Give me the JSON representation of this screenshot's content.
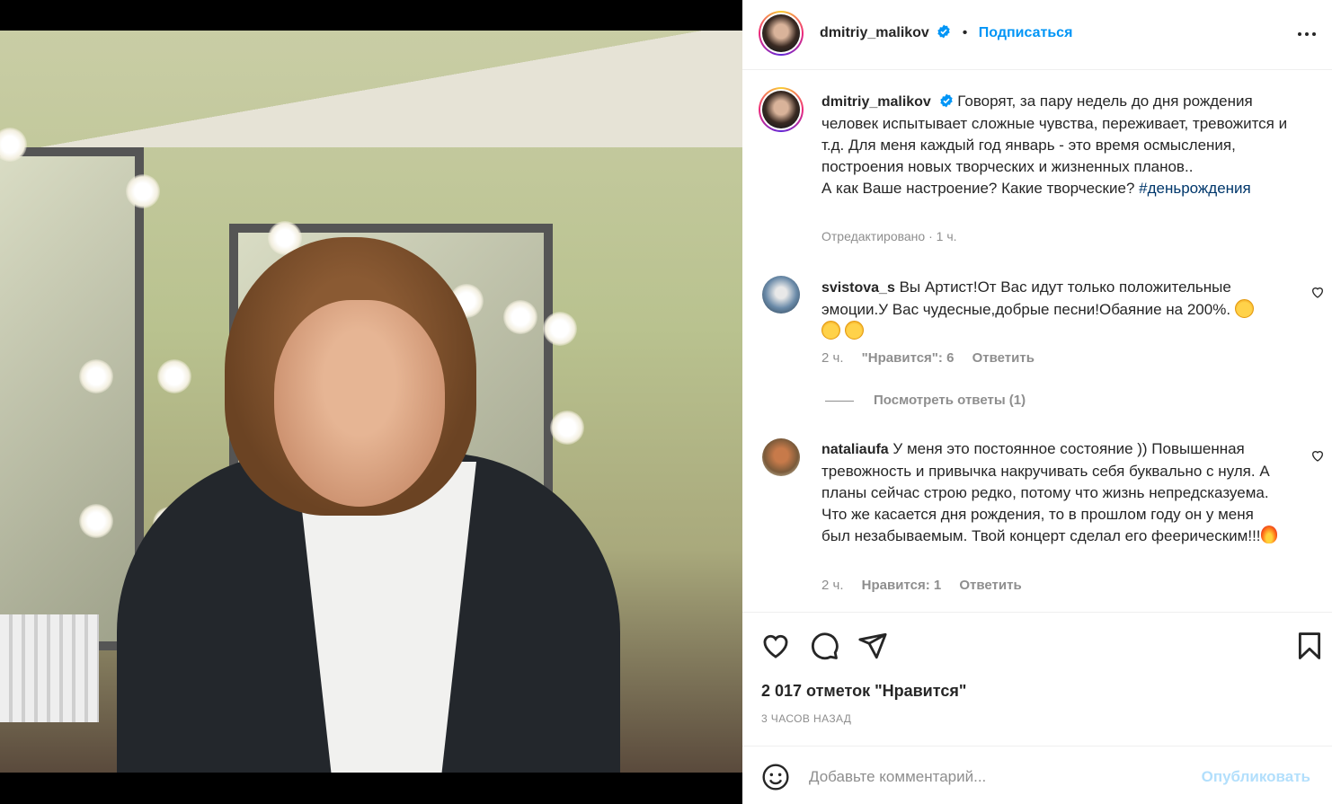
{
  "post": {
    "image_alt": "photo",
    "author": "dmitriy_malikov",
    "follow_label": "Подписаться",
    "dot": "•"
  },
  "caption": {
    "username": "dmitriy_malikov",
    "text": "Говорят, за пару недель до дня рождения человек испытывает сложные чувства, переживает, тревожится и т.д. Для меня каждый год январь - это время осмысления, построения новых творческих и жизненных планов..",
    "text2": "А как Ваше настроение? Какие творческие? ",
    "hashtag": "#деньрождения",
    "edited": "Отредактировано",
    "sep": " · ",
    "time": "1 ч."
  },
  "comments": [
    {
      "username": "svistova_s",
      "text": "Вы Артист!От Вас идут только положительные эмоции.У Вас чудесные,добрые песни!Обаяние на 200%.",
      "time": "2 ч.",
      "likes": "\"Нравится\": 6",
      "reply": "Ответить",
      "view_replies": "Посмотреть ответы (1)"
    },
    {
      "username": "nataliaufa",
      "text": "У меня это постоянное состояние )) Повышенная тревожность и привычка накручивать себя буквально с нуля. А планы сейчас строю редко, потому что жизнь непредсказуема. Что же касается дня рождения, то в прошлом году он у меня был незабываемым. Твой концерт сделал его феерическим!!!",
      "time": "2 ч.",
      "likes": "Нравится: 1",
      "reply": "Ответить"
    }
  ],
  "actions": {
    "likes": "2 017 отметок \"Нравится\"",
    "time": "3 ЧАСОВ НАЗАД"
  },
  "add_comment": {
    "placeholder": "Добавьте комментарий...",
    "publish": "Опубликовать"
  },
  "icons": [
    "verified-icon",
    "more-icon",
    "heart-icon",
    "comment-icon",
    "share-icon",
    "bookmark-icon",
    "smile-icon"
  ],
  "colors": {
    "accent": "#0095f6",
    "hashtag": "#00376b",
    "muted": "#8e8e8e",
    "publish_disabled": "#b2dffc"
  }
}
